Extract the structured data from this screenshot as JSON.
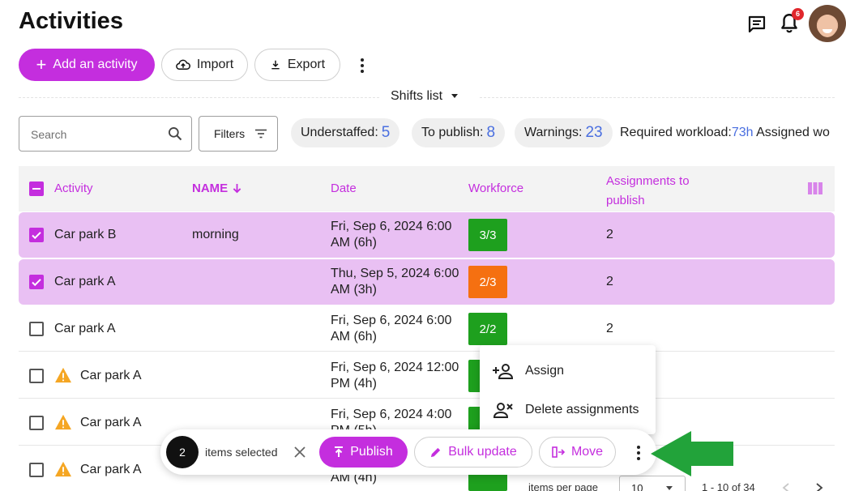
{
  "header": {
    "title": "Activities",
    "notifications_count": "6"
  },
  "toolbar": {
    "add_label": "Add an activity",
    "import_label": "Import",
    "export_label": "Export"
  },
  "shifts_select": {
    "value": "Shifts list"
  },
  "search": {
    "placeholder": "Search"
  },
  "filters_label": "Filters",
  "stats": {
    "understaffed_label": "Understaffed:",
    "understaffed_value": "5",
    "to_publish_label": "To publish:",
    "to_publish_value": "8",
    "warnings_label": "Warnings:",
    "warnings_value": "23",
    "workload_label": "Required workload:",
    "workload_value": "73h",
    "assigned_label": "Assigned wo"
  },
  "table": {
    "columns": {
      "activity": "Activity",
      "name": "NAME",
      "date": "Date",
      "workforce": "Workforce",
      "assignments_line1": "Assignments to",
      "assignments_line2": "publish"
    },
    "rows": [
      {
        "activity": "Car park B",
        "name": "morning",
        "date1": "Fri, Sep 6, 2024 6:00",
        "date2": "AM (6h)",
        "workforce": "3/3",
        "assignments": "2",
        "selected": true,
        "warning": false,
        "color": "#1ea01e"
      },
      {
        "activity": "Car park A",
        "name": "",
        "date1": "Thu, Sep 5, 2024 6:00",
        "date2": "AM (3h)",
        "workforce": "2/3",
        "assignments": "2",
        "selected": true,
        "warning": false,
        "color": "#f57011"
      },
      {
        "activity": "Car park A",
        "name": "",
        "date1": "Fri, Sep 6, 2024 6:00",
        "date2": "AM (6h)",
        "workforce": "2/2",
        "assignments": "2",
        "selected": false,
        "warning": false,
        "color": "#1ea01e"
      },
      {
        "activity": "Car park A",
        "name": "",
        "date1": "Fri, Sep 6, 2024 12:00",
        "date2": "PM (4h)",
        "workforce": "",
        "assignments": "",
        "selected": false,
        "warning": true,
        "color": "#1ea01e"
      },
      {
        "activity": "Car park A",
        "name": "",
        "date1": "Fri, Sep 6, 2024 4:00",
        "date2": "PM (5h)",
        "workforce": "",
        "assignments": "",
        "selected": false,
        "warning": true,
        "color": "#1ea01e"
      },
      {
        "activity": "Car park A",
        "name": "",
        "date1": "",
        "date2": "AM (4h)",
        "workforce": "",
        "assignments": "",
        "selected": false,
        "warning": true,
        "color": "#1ea01e"
      }
    ]
  },
  "context_menu": {
    "assign_label": "Assign",
    "delete_label": "Delete assignments"
  },
  "bulk_bar": {
    "count": "2",
    "selected_text": "items selected",
    "publish_label": "Publish",
    "bulk_update_label": "Bulk update",
    "move_label": "Move"
  },
  "pagination": {
    "per_page_label": "items per page",
    "per_page_value": "10",
    "range": "1 - 10 of 34"
  },
  "colors": {
    "accent": "#c42ede",
    "selected_row": "#e9c0f3",
    "full": "#1ea01e",
    "partial": "#f57011",
    "stat_number": "#4a6fe0",
    "annotation_arrow": "#22a33a"
  }
}
